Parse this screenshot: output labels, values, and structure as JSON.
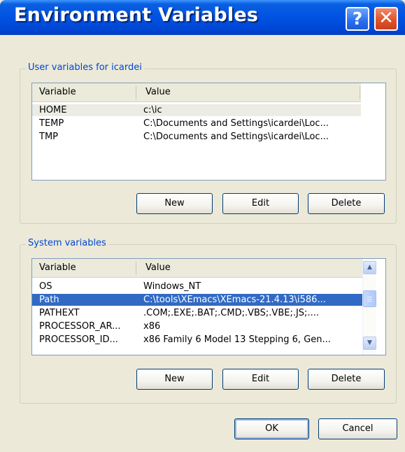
{
  "window": {
    "title": "Environment Variables"
  },
  "titlebar": {
    "help_label": "?",
    "close_label": "✕"
  },
  "user_group": {
    "legend": "User variables for icardei",
    "columns": [
      "Variable",
      "Value"
    ],
    "rows": [
      {
        "variable": "HOME",
        "value": "c:\\ic"
      },
      {
        "variable": "TEMP",
        "value": "C:\\Documents and Settings\\icardei\\Loc..."
      },
      {
        "variable": "TMP",
        "value": "C:\\Documents and Settings\\icardei\\Loc..."
      }
    ],
    "buttons": {
      "new": "New",
      "edit": "Edit",
      "delete": "Delete"
    }
  },
  "system_group": {
    "legend": "System variables",
    "columns": [
      "Variable",
      "Value"
    ],
    "rows": [
      {
        "variable": "OS",
        "value": "Windows_NT"
      },
      {
        "variable": "Path",
        "value": "C:\\tools\\XEmacs\\XEmacs-21.4.13\\i586..."
      },
      {
        "variable": "PATHEXT",
        "value": ".COM;.EXE;.BAT;.CMD;.VBS;.VBE;.JS;...."
      },
      {
        "variable": "PROCESSOR_AR...",
        "value": "x86"
      },
      {
        "variable": "PROCESSOR_ID...",
        "value": "x86 Family 6 Model 13 Stepping 6, Gen..."
      }
    ],
    "selected_row": "Path",
    "buttons": {
      "new": "New",
      "edit": "Edit",
      "delete": "Delete"
    }
  },
  "footer": {
    "ok": "OK",
    "cancel": "Cancel"
  },
  "colors": {
    "titlebar": "#0054e3",
    "selection": "#316ac5",
    "group_legend": "#0046d5",
    "dialog_bg": "#ece9d8"
  },
  "icons": {
    "help": "help-icon",
    "close": "close-icon",
    "scroll_up": "scroll-up-arrow-icon",
    "scroll_down": "scroll-down-arrow-icon"
  }
}
